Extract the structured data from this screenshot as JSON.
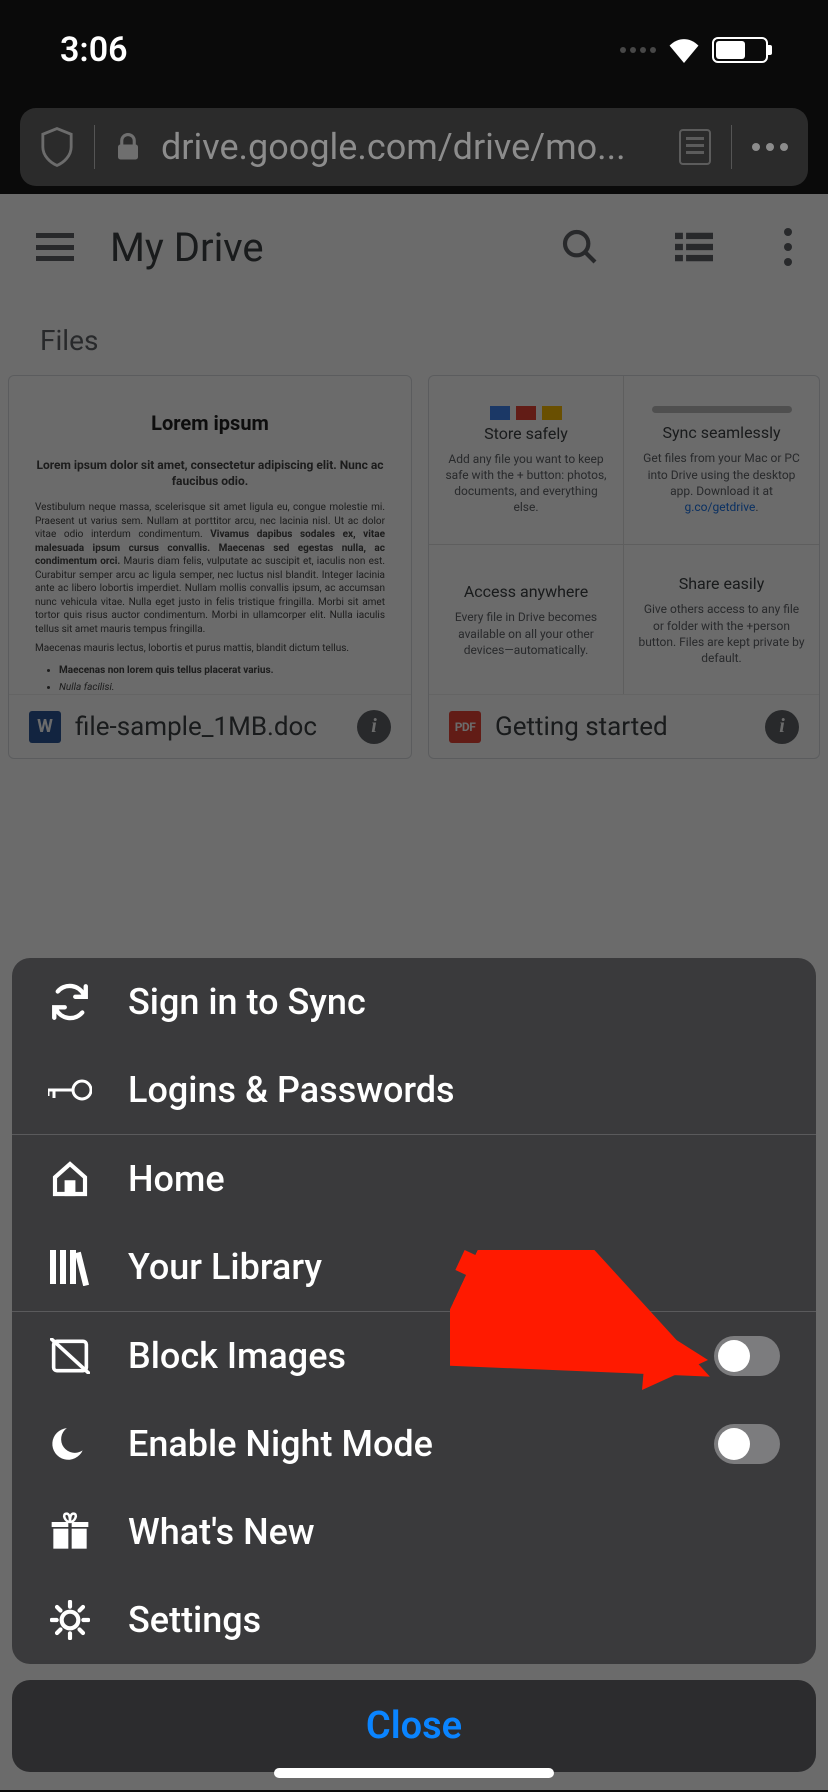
{
  "status": {
    "time": "3:06"
  },
  "url": {
    "display": "drive.google.com/drive/mo..."
  },
  "drive": {
    "title": "My Drive",
    "section_label": "Files",
    "file1": {
      "name": "file-sample_1MB.doc",
      "icon_letter": "W",
      "preview_title": "Lorem ipsum",
      "preview_sub": "Lorem ipsum dolor sit amet, consectetur adipiscing elit. Nunc ac faucibus odio."
    },
    "file2": {
      "name": "Getting started",
      "icon_letter": "PDF"
    },
    "gs": {
      "c1_title": "Store safely",
      "c1_text": "Add any file you want to keep safe with the + button: photos, documents, and everything else.",
      "c2_title": "Sync seamlessly",
      "c2_text_a": "Get files from your Mac or PC into Drive using the desktop app. Download it at ",
      "c2_link": "g.co/getdrive",
      "c3_title": "Access anywhere",
      "c3_text": "Every file in Drive becomes available on all your other devices—automatically.",
      "c4_title": "Share easily",
      "c4_text": "Give others access to any file or folder with the +person button. Files are kept private by default."
    }
  },
  "menu": {
    "sign_in": "Sign in to Sync",
    "logins": "Logins & Passwords",
    "home": "Home",
    "library": "Your Library",
    "block_images": "Block Images",
    "night_mode": "Enable Night Mode",
    "whats_new": "What's New",
    "settings": "Settings",
    "close": "Close"
  }
}
